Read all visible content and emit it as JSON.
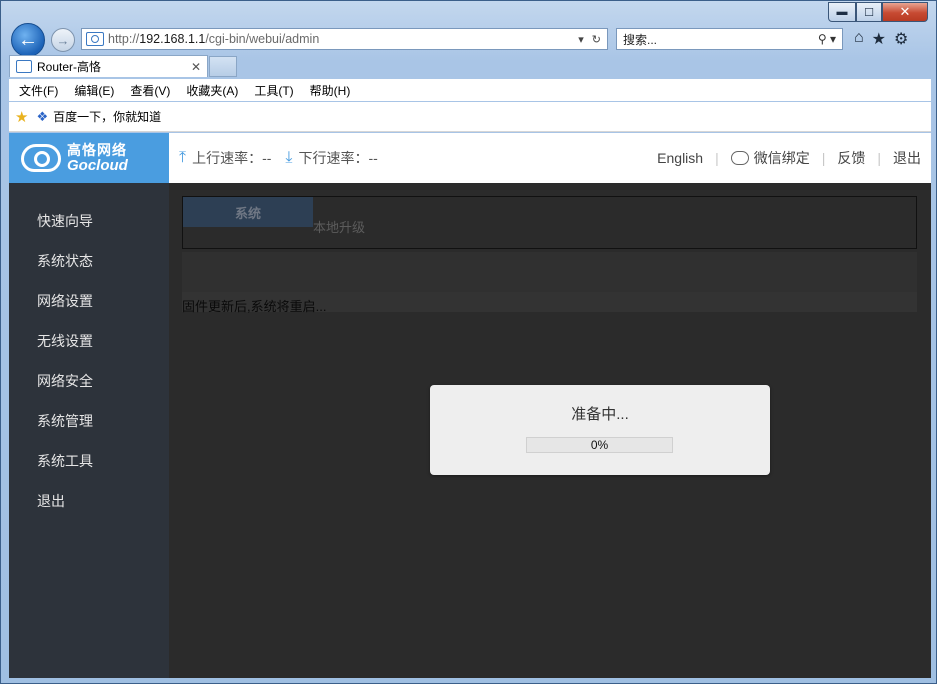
{
  "browser": {
    "address": {
      "prefix": "http://",
      "host": "192.168.1.1",
      "path": "/cgi-bin/webui/admin"
    },
    "search_placeholder": "搜索...",
    "tab_title": "Router-高恪",
    "menu": [
      "文件(F)",
      "编辑(E)",
      "查看(V)",
      "收藏夹(A)",
      "工具(T)",
      "帮助(H)"
    ],
    "favorites": [
      "百度一下，你就知道"
    ]
  },
  "header": {
    "logo_cn": "高恪网络",
    "logo_en": "Gocloud",
    "upload_label": "上行速率：--",
    "download_label": "下行速率：--",
    "links": {
      "english": "English",
      "wechat": "微信绑定",
      "feedback": "反馈",
      "logout": "退出"
    }
  },
  "sidebar": {
    "items": [
      "快速向导",
      "系统状态",
      "网络设置",
      "无线设置",
      "网络安全",
      "系统管理",
      "系统工具",
      "退出"
    ]
  },
  "content": {
    "system_tab": "系统",
    "subtab": "本地升级",
    "notice": "固件更新后,系统将重启..."
  },
  "modal": {
    "title": "准备中...",
    "progress_text": "0%",
    "progress_value": 0
  }
}
